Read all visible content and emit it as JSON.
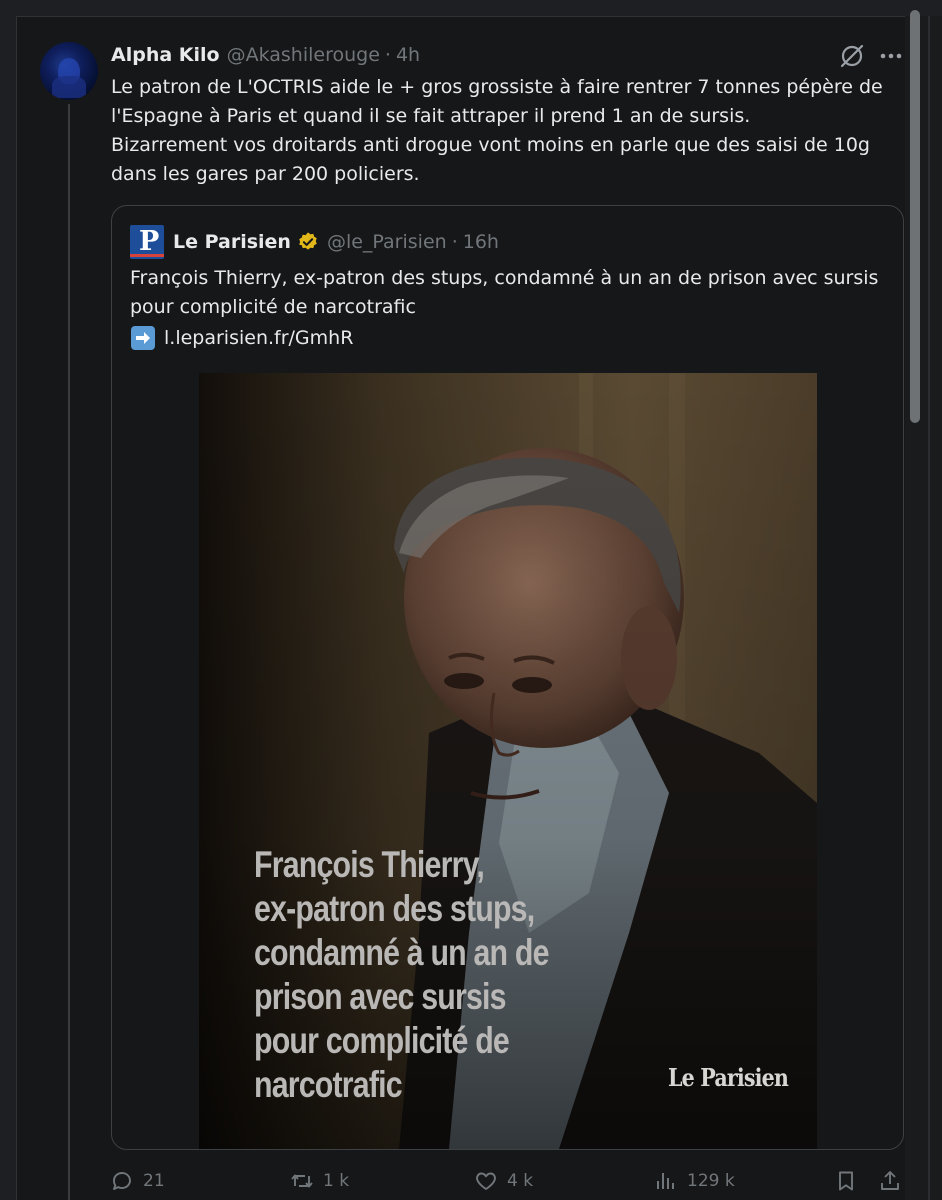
{
  "tweet": {
    "author_name": "Alpha Kilo",
    "author_handle": "@Akashilerouge",
    "separator": "·",
    "time": "4h",
    "text": "Le patron de L'OCTRIS aide le + gros grossiste à faire  rentrer 7 tonnes pépère de l'Espagne à Paris et quand il se fait attraper il prend 1 an de sursis.\nBizarrement vos droitards anti drogue vont moins en parle que des saisi de 10g dans les gares par 200 policiers."
  },
  "quote": {
    "author_name": "Le Parisien",
    "author_handle": "@le_Parisien",
    "separator": "·",
    "time": "16h",
    "logo_letter": "P",
    "text": "François Thierry, ex-patron des stups, condamné à un an de prison avec sursis pour complicité de narcotrafic",
    "link": "l.leparisien.fr/GmhR",
    "media": {
      "caption_lines": [
        "François Thierry,",
        "ex-patron des stups,",
        "condamné à un an de",
        "prison avec sursis",
        "pour complicité de",
        "narcotrafic"
      ],
      "watermark": "Le Parisien"
    }
  },
  "actions": {
    "replies": "21",
    "reposts": "1 k",
    "likes": "4 k",
    "views": "129 k"
  },
  "icons": {
    "grok": "grok-icon",
    "more": "more-icon",
    "verified": "verified-badge-icon",
    "link_arrow": "arrow-right-icon",
    "reply": "reply-icon",
    "repost": "repost-icon",
    "like": "heart-icon",
    "views": "analytics-icon",
    "bookmark": "bookmark-icon",
    "share": "share-icon"
  },
  "colors": {
    "background": "#161718",
    "text": "#e7e9ea",
    "muted": "#71767b",
    "verified": "#e2b719",
    "border": "#3e4144"
  }
}
